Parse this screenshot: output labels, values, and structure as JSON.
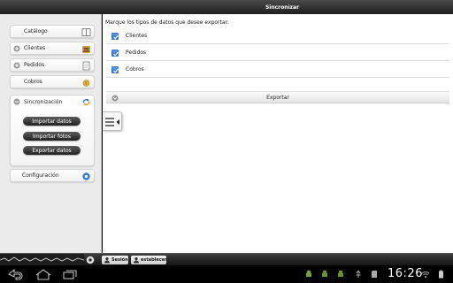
{
  "titlebar": {
    "title": "Sincronizar"
  },
  "sidebar": {
    "items": [
      {
        "label": "Catálogo",
        "icon": "book-icon"
      },
      {
        "label": "Clientes",
        "icon": "customers-icon"
      },
      {
        "label": "Pedidos",
        "icon": "orders-icon"
      },
      {
        "label": "Cobros",
        "icon": "coins-icon"
      }
    ],
    "sync": {
      "label": "Sincronización",
      "icon": "sync-icon",
      "buttons": [
        "Importar datos",
        "Importar fotos",
        "Exportar datos"
      ]
    },
    "config": {
      "label": "Configuración",
      "icon": "settings-icon"
    }
  },
  "main": {
    "prompt": "Marque los tipos de datos que desee exportar:",
    "options": [
      {
        "label": "Clientes",
        "checked": true
      },
      {
        "label": "Pedidos",
        "checked": true
      },
      {
        "label": "Cobros",
        "checked": true
      }
    ],
    "export_label": "Exportar"
  },
  "bottombar": {
    "session_label": "Sesión",
    "establish_label": "establecer"
  },
  "statusbar": {
    "time": "16:26"
  },
  "colors": {
    "accent": "#2f70c4",
    "titlebar": "#2a2a2a"
  }
}
